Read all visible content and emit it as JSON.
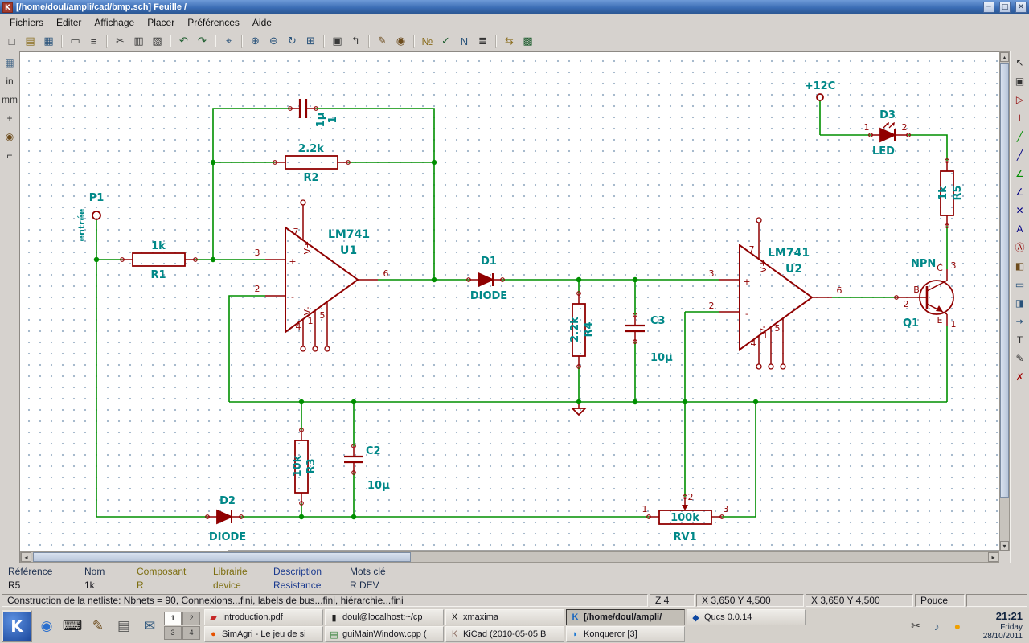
{
  "window": {
    "title": "[/home/doul/ampli/cad/bmp.sch]  Feuille /",
    "minimize": "─",
    "maximize": "□",
    "close": "✕",
    "app_initial": "K"
  },
  "menubar": {
    "items": [
      "Fichiers",
      "Editer",
      "Affichage",
      "Placer",
      "Préférences",
      "Aide"
    ]
  },
  "toolbar_top": {
    "icons": [
      {
        "name": "new-schematic-icon",
        "glyph": "□"
      },
      {
        "name": "open-schematic-icon",
        "glyph": "▤",
        "color": "#8a6d1d"
      },
      {
        "name": "save-schematic-icon",
        "glyph": "▦",
        "color": "#28527a"
      },
      {
        "name": "separator",
        "glyph": ""
      },
      {
        "name": "page-settings-icon",
        "glyph": "▭"
      },
      {
        "name": "print-icon",
        "glyph": "≡",
        "color": "#333333"
      },
      {
        "name": "separator",
        "glyph": ""
      },
      {
        "name": "cut-icon",
        "glyph": "✂"
      },
      {
        "name": "copy-icon",
        "glyph": "▥"
      },
      {
        "name": "paste-icon",
        "glyph": "▧"
      },
      {
        "name": "separator",
        "glyph": ""
      },
      {
        "name": "undo-icon",
        "glyph": "↶",
        "color": "#1d5c2e"
      },
      {
        "name": "redo-icon",
        "glyph": "↷",
        "color": "#1d5c2e"
      },
      {
        "name": "separator",
        "glyph": ""
      },
      {
        "name": "find-icon",
        "glyph": "⌖",
        "color": "#28527a"
      },
      {
        "name": "separator",
        "glyph": ""
      },
      {
        "name": "zoom-in-icon",
        "glyph": "⊕",
        "color": "#28527a"
      },
      {
        "name": "zoom-out-icon",
        "glyph": "⊖",
        "color": "#28527a"
      },
      {
        "name": "zoom-redraw-icon",
        "glyph": "↻",
        "color": "#28527a"
      },
      {
        "name": "zoom-fit-icon",
        "glyph": "⊞",
        "color": "#28527a"
      },
      {
        "name": "separator",
        "glyph": ""
      },
      {
        "name": "hierarchy-navigator-icon",
        "glyph": "▣"
      },
      {
        "name": "leave-sheet-icon",
        "glyph": "↰"
      },
      {
        "name": "separator",
        "glyph": ""
      },
      {
        "name": "library-editor-icon",
        "glyph": "✎",
        "color": "#6d4c1d"
      },
      {
        "name": "library-browser-icon",
        "glyph": "◉",
        "color": "#6d4c1d"
      },
      {
        "name": "separator",
        "glyph": ""
      },
      {
        "name": "annotate-icon",
        "glyph": "№",
        "color": "#8a6d1d"
      },
      {
        "name": "erc-icon",
        "glyph": "✓",
        "color": "#1d5c2e"
      },
      {
        "name": "netlist-icon",
        "glyph": "N",
        "color": "#28527a"
      },
      {
        "name": "bom-icon",
        "glyph": "≣",
        "color": "#333333"
      },
      {
        "name": "separator",
        "glyph": ""
      },
      {
        "name": "cvpcb-icon",
        "glyph": "⇆",
        "color": "#8a6d1d"
      },
      {
        "name": "pcbnew-icon",
        "glyph": "▩",
        "color": "#1d5c2e"
      }
    ]
  },
  "toolbar_left": {
    "icons": [
      {
        "name": "grid-toggle-icon",
        "glyph": "▦",
        "color": "#4a6b8a"
      },
      {
        "name": "units-inch-icon",
        "glyph": "in",
        "color": "#333333"
      },
      {
        "name": "units-mm-icon",
        "glyph": "mm",
        "color": "#333333"
      },
      {
        "name": "cursor-shape-icon",
        "glyph": "+",
        "color": "#333333"
      },
      {
        "name": "hidden-pins-icon",
        "glyph": "◉",
        "color": "#6d4c1d"
      },
      {
        "name": "hv-wires-icon",
        "glyph": "⌐",
        "color": "#333333"
      }
    ]
  },
  "toolbar_right": {
    "icons": [
      {
        "name": "cancel-tool-icon",
        "glyph": "↖",
        "color": "#333333"
      },
      {
        "name": "hierarchy-nav-icon",
        "glyph": "▣",
        "color": "#333333"
      },
      {
        "name": "add-component-icon",
        "glyph": "▷",
        "color": "#900000"
      },
      {
        "name": "add-power-icon",
        "glyph": "⊥",
        "color": "#900000"
      },
      {
        "name": "add-wire-icon",
        "glyph": "╱",
        "color": "#008f00"
      },
      {
        "name": "add-bus-icon",
        "glyph": "╱",
        "color": "#000084"
      },
      {
        "name": "wire-to-bus-icon",
        "glyph": "∠",
        "color": "#008f00"
      },
      {
        "name": "bus-to-bus-icon",
        "glyph": "∠",
        "color": "#000084"
      },
      {
        "name": "no-connect-icon",
        "glyph": "✕",
        "color": "#000084"
      },
      {
        "name": "add-label-icon",
        "glyph": "A",
        "color": "#000084"
      },
      {
        "name": "add-global-label-icon",
        "glyph": "Ⓐ",
        "color": "#900000"
      },
      {
        "name": "add-hier-label-icon",
        "glyph": "◧",
        "color": "#6d4c1d"
      },
      {
        "name": "add-sheet-icon",
        "glyph": "▭",
        "color": "#28527a"
      },
      {
        "name": "import-sheet-pin-icon",
        "glyph": "◨",
        "color": "#28527a"
      },
      {
        "name": "add-sheet-pin-icon",
        "glyph": "⇥",
        "color": "#28527a"
      },
      {
        "name": "add-text-icon",
        "glyph": "T",
        "color": "#333333"
      },
      {
        "name": "add-polyline-icon",
        "glyph": "✎",
        "color": "#333333"
      },
      {
        "name": "delete-icon",
        "glyph": "✗",
        "color": "#a00000"
      }
    ]
  },
  "schematic": {
    "labels": {
      "p1_ref": "P1",
      "p1_name": "entrée",
      "r1_value": "1k",
      "r1_ref": "R1",
      "r2_value": "2.2k",
      "r2_ref": "R2",
      "r3_value": "10k",
      "r3_ref": "R3",
      "r4_value": "2.2k",
      "r4_ref": "R4",
      "r5_value": "1k",
      "r5_ref": "R5",
      "c1_value": "1µ",
      "c1_ref": "1",
      "c2_ref": "C2",
      "c2_value": "10µ",
      "c3_ref": "C3",
      "c3_value": "10µ",
      "d1_ref": "D1",
      "d1_value": "DIODE",
      "d2_ref": "D2",
      "d2_value": "DIODE",
      "d3_ref": "D3",
      "d3_value": "LED",
      "u1_value": "LM741",
      "u1_ref": "U1",
      "u2_value": "LM741",
      "u2_ref": "U2",
      "q1_value": "NPN",
      "q1_ref": "Q1",
      "rv1_value": "100k",
      "rv1_ref": "RV1",
      "power_label": "+12C",
      "pin1": "1",
      "pin2": "2",
      "pin3": "3",
      "pin4": "4",
      "pin5": "5",
      "pin6": "6",
      "pin7": "7",
      "plus": "+",
      "minus": "-",
      "vplus": "V+",
      "vminus": "V-",
      "b": "B",
      "c": "C",
      "e": "E"
    }
  },
  "infobar": {
    "fields": [
      {
        "label": "Référence",
        "value": "R5"
      },
      {
        "label": "Nom",
        "value": "1k"
      },
      {
        "label": "Composant",
        "value": "R"
      },
      {
        "label": "Librairie",
        "value": "device"
      },
      {
        "label": "Description",
        "value": "Resistance"
      },
      {
        "label": "Mots clé",
        "value": "R DEV"
      }
    ]
  },
  "statusbar": {
    "message": "Construction de la netliste: Nbnets = 90,  Connexions...fini,  labels de bus...fini, hiérarchie...fini",
    "zoom": "Z 4",
    "abs": "X 3,650  Y 4,500",
    "rel": "X 3,650  Y 4,500",
    "units": "Pouce"
  },
  "taskbar": {
    "kmenu_label": "K",
    "launchers": [
      {
        "name": "konqueror-launcher",
        "glyph": "◉",
        "color": "#2a6fce"
      },
      {
        "name": "terminal-launcher",
        "glyph": "⌨",
        "color": "#222222"
      },
      {
        "name": "editor-launcher",
        "glyph": "✎",
        "color": "#6d4c1d"
      },
      {
        "name": "printer-launcher",
        "glyph": "▤",
        "color": "#555555"
      },
      {
        "name": "mail-launcher",
        "glyph": "✉",
        "color": "#28527a"
      }
    ],
    "pager": [
      "1",
      "2",
      "3",
      "4"
    ],
    "tasks_row1": [
      {
        "name": "task-introduction-pdf",
        "icon": "▰",
        "color": "#c62828",
        "label": "Introduction.pdf"
      },
      {
        "name": "task-terminal",
        "icon": "▮",
        "color": "#222222",
        "label": "doul@localhost:~/cp"
      },
      {
        "name": "task-xmaxima",
        "icon": "X",
        "color": "#111111",
        "label": "xmaxima"
      },
      {
        "name": "task-eeschema",
        "icon": "K",
        "color": "#1565c0",
        "label": "[/home/doul/ampli/",
        "active": true
      },
      {
        "name": "task-qucs",
        "icon": "◆",
        "color": "#0d47a1",
        "label": "Qucs 0.0.14"
      }
    ],
    "tasks_row2": [
      {
        "name": "task-simagri",
        "icon": "●",
        "color": "#e65100",
        "label": "SimAgri - Le jeu de si"
      },
      {
        "name": "task-guimainwindow",
        "icon": "▤",
        "color": "#2e7d32",
        "label": "guiMainWindow.cpp ("
      },
      {
        "name": "task-kicad",
        "icon": "K",
        "color": "#8d6e63",
        "label": "KiCad (2010-05-05 B"
      },
      {
        "name": "task-konqueror",
        "icon": "◗",
        "color": "#1976d2",
        "label": "Konqueror [3]"
      }
    ],
    "tray": [
      {
        "name": "klipper-tray-icon",
        "glyph": "✂",
        "color": "#333333"
      },
      {
        "name": "volume-tray-icon",
        "glyph": "♪",
        "color": "#28527a"
      },
      {
        "name": "reminder-tray-icon",
        "glyph": "●",
        "color": "#f0a000"
      }
    ],
    "clock": {
      "time": "21:21",
      "day": "Friday",
      "date": "28/10/2011"
    }
  }
}
